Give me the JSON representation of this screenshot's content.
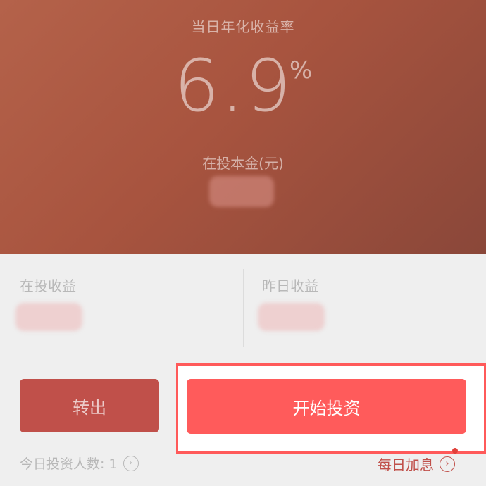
{
  "hero": {
    "title": "当日年化收益率",
    "rate_value": "6.9",
    "rate_unit": "%",
    "principal_label": "在投本金(元)"
  },
  "stats": {
    "invest_income_label": "在投收益",
    "yesterday_income_label": "昨日收益"
  },
  "actions": {
    "transfer_out_label": "转出",
    "start_invest_label": "开始投资",
    "today_investors_label": "今日投资人数: 1",
    "daily_bonus_label": "每日加息"
  },
  "colors": {
    "hero_start": "#b4624a",
    "hero_end": "#8a4739",
    "primary_button": "#ff5b5b",
    "secondary_button": "#c0504a",
    "highlight_border": "#ff5a5a"
  },
  "icons": {
    "circle_chevron": "chevron-right-circle-icon"
  }
}
